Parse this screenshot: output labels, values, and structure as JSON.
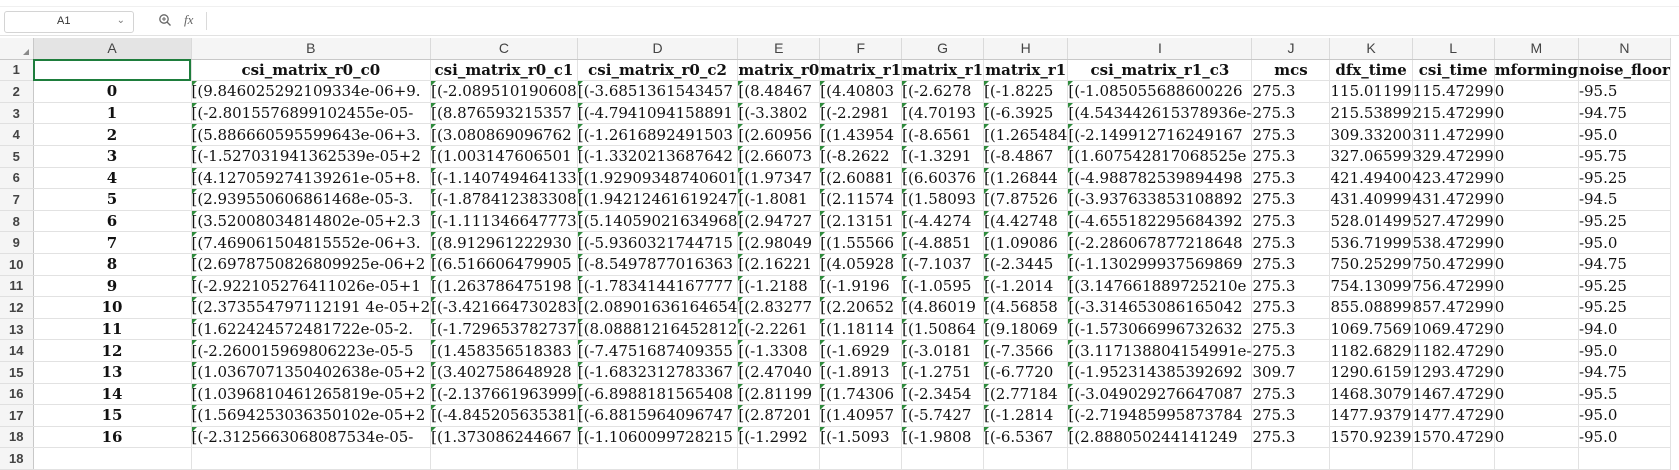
{
  "name_box": {
    "value": "A1"
  },
  "formula_bar": {
    "content": ""
  },
  "colors": {
    "selection": "#1e7d3c",
    "text_marker": "#2e8b3c",
    "header_bg": "#f5f5f5"
  },
  "icons": {
    "zoom": "zoom-magnifier-icon",
    "fx": "function-icon",
    "dropdown": "chevron-down-icon"
  },
  "columns": [
    "A",
    "B",
    "C",
    "D",
    "E",
    "F",
    "G",
    "H",
    "I",
    "J",
    "K",
    "L",
    "M",
    "N"
  ],
  "header_row": [
    "",
    "csi_matrix_r0_c0",
    "csi_matrix_r0_c1",
    "csi_matrix_r0_c2",
    "matrix_r0",
    "matrix_r1",
    "matrix_r1",
    "matrix_r1",
    "csi_matrix_r1_c3",
    "mcs",
    "dfx_time",
    "csi_time",
    "mforming",
    "noise_floor"
  ],
  "row_numbers": [
    "1",
    "2",
    "3",
    "4",
    "5",
    "6",
    "7",
    "8",
    "9",
    "10",
    "11",
    "12",
    "13",
    "14",
    "15",
    "16",
    "17",
    "18"
  ],
  "rows": [
    [
      "0",
      "[(9.846025292109334e-06+9.",
      "[(-2.089510190608",
      "[(-3.6851361543457",
      "[(8.48467",
      "[(4.40803",
      "[(-2.6278",
      "[(-1.8225",
      "[(-1.085055688600226",
      "275.3",
      "115.01199",
      "115.47299",
      "0",
      "-95.5"
    ],
    [
      "1",
      "[(-2.8015576899102455e-05-",
      "[(8.876593215357",
      "[(-4.7941094158891",
      "[(-3.3802",
      "[(-2.2981",
      "[(4.70193",
      "[(-6.3925",
      "[(4.543442615378936e-",
      "275.3",
      "215.53899",
      "215.47299",
      "0",
      "-94.75"
    ],
    [
      "2",
      "[(5.886660595599643e-06+3.",
      "[(3.080869096762",
      "[(-1.2616892491503",
      "[(2.60956",
      "[(1.43954",
      "[(-8.6561",
      "[(1.265484",
      "[(-2.149912716249167",
      "275.3",
      "309.33200",
      "311.47299",
      "0",
      "-95.0"
    ],
    [
      "3",
      "[(-1.527031941362539e-05+2",
      "[(1.003147606501",
      "[(-1.3320213687642",
      "[(2.66073",
      "[(-8.2622",
      "[(-1.3291",
      "[(-8.4867",
      "[(1.607542817068525e",
      "275.3",
      "327.06599",
      "329.47299",
      "0",
      "-95.75"
    ],
    [
      "4",
      "[(4.127059274139261e-05+8.",
      "[(-1.140749464133",
      "[(1.92909348740601",
      "[(1.97347",
      "[(2.60881",
      "[(6.60376",
      "[(1.26844",
      "[(-4.988782539894498",
      "275.3",
      "421.49400",
      "423.47299",
      "0",
      "-95.25"
    ],
    [
      "5",
      "[(2.939550606861468e-05-3.",
      "[(-1.878412383308",
      "[(1.94212461619247",
      "[(-1.8081",
      "[(2.11574",
      "[(1.58093",
      "[(7.87526",
      "[(-3.937633853108892",
      "275.3",
      "431.40999",
      "431.47299",
      "0",
      "-94.5"
    ],
    [
      "6",
      "[(3.52008034814802e-05+2.3",
      "[(-1.111346647773",
      "[(5.14059021634968",
      "[(2.94727",
      "[(2.13151",
      "[(-4.4274",
      "[(4.42748",
      "[(-4.655182295684392",
      "275.3",
      "528.01499",
      "527.47299",
      "0",
      "-95.25"
    ],
    [
      "7",
      "[(7.469061504815552e-06+3.",
      "[(8.912961222930",
      "[(-5.9360321744715",
      "[(2.98049",
      "[(1.55566",
      "[(-4.8851",
      "[(1.09086",
      "[(-2.286067877218648",
      "275.3",
      "536.71999",
      "538.47299",
      "0",
      "-95.0"
    ],
    [
      "8",
      "[(2.6978750826809925e-06+2",
      "[(6.516606479905",
      "[(-8.5497877016363",
      "[(2.16221",
      "[(4.05928",
      "[(-7.1037",
      "[(-2.3445",
      "[(-1.130299937569869",
      "275.3",
      "750.25299",
      "750.47299",
      "0",
      "-94.75"
    ],
    [
      "9",
      "[(-2.922105276411026e-05+1",
      "[(1.263786475198",
      "[(-1.7834144167777",
      "[(-1.2188",
      "[(-1.9196",
      "[(-1.0595",
      "[(-1.2014",
      "[(3.147661889725210e",
      "275.3",
      "754.13099",
      "756.47299",
      "0",
      "-95.25"
    ],
    [
      "10",
      "[(2.373554797112191 4e-05+2",
      "[(-3.421664730283",
      "[(2.08901636164654",
      "[(2.83277",
      "[(2.20652",
      "[(4.86019",
      "[(4.56858",
      "[(-3.314653086165042",
      "275.3",
      "855.08899",
      "857.47299",
      "0",
      "-95.25"
    ],
    [
      "11",
      "[(1.622424572481722e-05-2.",
      "[(-1.729653782737",
      "[(8.08881216452812",
      "[(-2.2261",
      "[(1.18114",
      "[(1.50864",
      "[(9.18069",
      "[(-1.573066996732632",
      "275.3",
      "1069.7569",
      "1069.4729",
      "0",
      "-94.0"
    ],
    [
      "12",
      "[(-2.260015969806223e-05-5",
      "[(1.458356518383",
      "[(-7.4751687409355",
      "[(-1.3308",
      "[(-1.6929",
      "[(-3.0181",
      "[(-7.3566",
      "[(3.117138804154991e-",
      "275.3",
      "1182.6829",
      "1182.4729",
      "0",
      "-95.0"
    ],
    [
      "13",
      "[(1.0367071350402638e-05+2",
      "[(3.402758648928",
      "[(-1.6832312783367",
      "[(2.47040",
      "[(-1.8913",
      "[(-1.2751",
      "[(-6.7720",
      "[(-1.952314385392692",
      "309.7",
      "1290.6159",
      "1293.4729",
      "0",
      "-94.75"
    ],
    [
      "14",
      "[(1.0396810461265819e-05+2",
      "[(-2.137661963999",
      "[(-6.8988181565408",
      "[(2.81199",
      "[(1.74306",
      "[(-2.3454",
      "[(2.77184",
      "[(-3.049029276647087",
      "275.3",
      "1468.3079",
      "1467.4729",
      "0",
      "-95.5"
    ],
    [
      "15",
      "[(1.5694253036350102e-05+2",
      "[(-4.845205635381",
      "[(-6.8815964096747",
      "[(2.87201",
      "[(1.40957",
      "[(-5.7427",
      "[(-1.2814",
      "[(-2.719485995873784",
      "275.3",
      "1477.9379",
      "1477.4729",
      "0",
      "-95.0"
    ],
    [
      "16",
      "[(-2.3125663068087534e-05-",
      "[(1.373086244667",
      "[(-1.1060099728215",
      "[(-1.2992",
      "[(-1.5093",
      "[(-1.9808",
      "[(-6.5367",
      "[(2.888050244141249",
      "275.3",
      "1570.9239",
      "1570.4729",
      "0",
      "-95.0"
    ]
  ]
}
